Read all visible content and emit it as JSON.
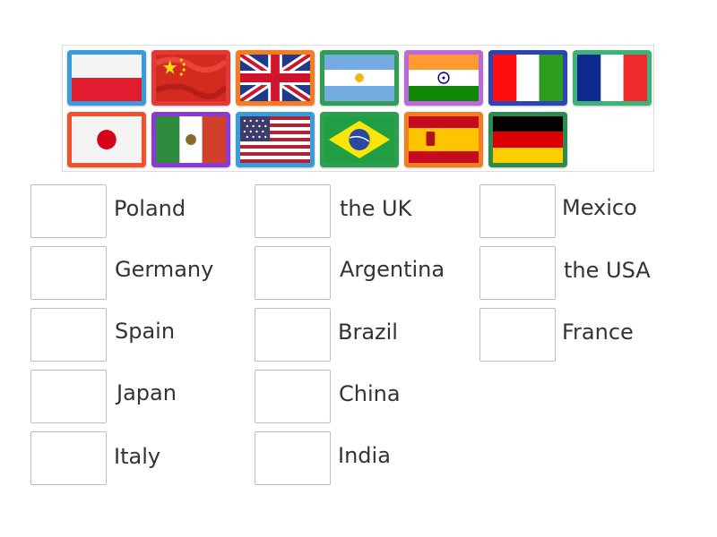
{
  "flags": [
    {
      "icon": "poland-flag-icon",
      "frame": "#3a9bdc"
    },
    {
      "icon": "china-flag-icon",
      "frame": "#e53935"
    },
    {
      "icon": "uk-flag-icon",
      "frame": "#f57c1f"
    },
    {
      "icon": "argentina-flag-icon",
      "frame": "#2e9e52"
    },
    {
      "icon": "india-flag-icon",
      "frame": "#b96ad8"
    },
    {
      "icon": "italy-flag-icon",
      "frame": "#2b45b5"
    },
    {
      "icon": "france-flag-icon",
      "frame": "#3db37b"
    },
    {
      "icon": "japan-flag-icon",
      "frame": "#f0522d"
    },
    {
      "icon": "mexico-flag-icon",
      "frame": "#8a3bd6"
    },
    {
      "icon": "usa-flag-icon",
      "frame": "#3a9bdc"
    },
    {
      "icon": "brazil-flag-icon",
      "frame": "#2e9e52"
    },
    {
      "icon": "spain-flag-icon",
      "frame": "#f57c1f"
    },
    {
      "icon": "germany-flag-icon",
      "frame": "#2e8b4e"
    }
  ],
  "answers": {
    "col1": [
      "Poland",
      "Germany",
      "Spain",
      "Japan",
      "Italy"
    ],
    "col2": [
      "the UK",
      "Argentina",
      "Brazil",
      "China",
      "India"
    ],
    "col3": [
      "Mexico",
      "the USA",
      "France"
    ]
  }
}
